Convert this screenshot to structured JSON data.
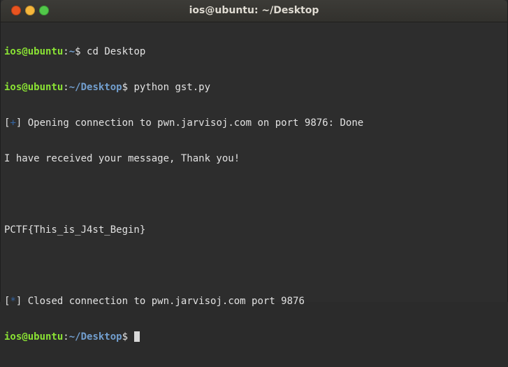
{
  "window": {
    "title": "ios@ubuntu: ~/Desktop",
    "colors": {
      "close": "#e95420",
      "minimize": "#f6b73c",
      "maximize": "#51c749",
      "prompt_user": "#8ae234",
      "prompt_path": "#729fcf"
    }
  },
  "terminal": {
    "lines": [
      {
        "user": "ios@ubuntu",
        "sep": ":",
        "path": "~",
        "dollar": "$ ",
        "cmd": "cd Desktop"
      },
      {
        "user": "ios@ubuntu",
        "sep": ":",
        "path": "~/Desktop",
        "dollar": "$ ",
        "cmd": "python gst.py"
      },
      {
        "lb": "[",
        "sym": "+",
        "rb": "]",
        "text": " Opening connection to pwn.jarvisoj.com on port 9876: Done"
      },
      {
        "text": "I have received your message, Thank you!"
      },
      {
        "text": ""
      },
      {
        "text": "PCTF{This_is_J4st_Begin}"
      },
      {
        "text": ""
      },
      {
        "lb": "[",
        "sym": "*",
        "rb": "]",
        "text": " Closed connection to pwn.jarvisoj.com port 9876"
      },
      {
        "user": "ios@ubuntu",
        "sep": ":",
        "path": "~/Desktop",
        "dollar": "$ "
      }
    ]
  }
}
